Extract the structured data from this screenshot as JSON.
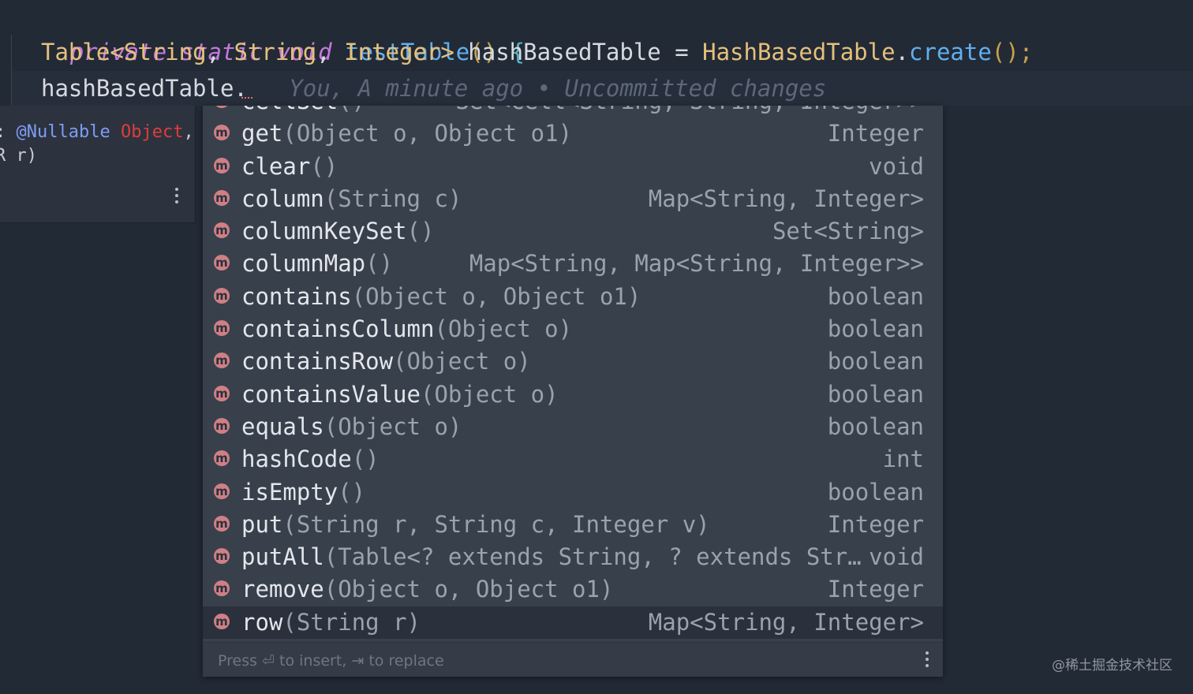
{
  "editor": {
    "line1": {
      "modifiers": "private static void",
      "method": "testTable",
      "parens": "()",
      "brace": "{"
    },
    "line2": {
      "table_type": "Table",
      "lt": "<",
      "generic1": "String",
      "comma1": ", ",
      "generic2": "String",
      "comma2": ", ",
      "generic3": "Integer",
      "gt": ">",
      "var": " hashBasedTable = ",
      "class": "HashBasedTable",
      "dot": ".",
      "create": "create",
      "call": "();"
    },
    "line3": {
      "text": "hashBasedTable.",
      "blame": "You, A minute ago • Uncommitted changes"
    }
  },
  "param_popup": {
    "prefix": ": ",
    "annotation": "@Nullable",
    "object": "Object",
    "comma": ",",
    "line2": "R r)"
  },
  "completion": {
    "items": [
      {
        "name": "cellSet",
        "sig": "()",
        "type": "Set<Cell<String, String, Integer>>"
      },
      {
        "name": "get",
        "sig": "(Object o, Object o1)",
        "type": "Integer"
      },
      {
        "name": "clear",
        "sig": "()",
        "type": "void"
      },
      {
        "name": "column",
        "sig": "(String c)",
        "type": "Map<String, Integer>"
      },
      {
        "name": "columnKeySet",
        "sig": "()",
        "type": "Set<String>"
      },
      {
        "name": "columnMap",
        "sig": "()",
        "type": "Map<String, Map<String, Integer>>"
      },
      {
        "name": "contains",
        "sig": "(Object o, Object o1)",
        "type": "boolean"
      },
      {
        "name": "containsColumn",
        "sig": "(Object o)",
        "type": "boolean"
      },
      {
        "name": "containsRow",
        "sig": "(Object o)",
        "type": "boolean"
      },
      {
        "name": "containsValue",
        "sig": "(Object o)",
        "type": "boolean"
      },
      {
        "name": "equals",
        "sig": "(Object o)",
        "type": "boolean"
      },
      {
        "name": "hashCode",
        "sig": "()",
        "type": "int"
      },
      {
        "name": "isEmpty",
        "sig": "()",
        "type": "boolean"
      },
      {
        "name": "put",
        "sig": "(String r, String c, Integer v)",
        "type": "Integer"
      },
      {
        "name": "putAll",
        "sig": "(Table<? extends String, ? extends Str…",
        "type": "void"
      },
      {
        "name": "remove",
        "sig": "(Object o, Object o1)",
        "type": "Integer"
      },
      {
        "name": "row",
        "sig": "(String r)",
        "type": "Map<String, Integer>"
      }
    ],
    "item_icon_letter": "m",
    "selected_index": 16,
    "footer": "Press ⏎ to insert, ⇥ to replace"
  },
  "watermark": "@稀土掘金技术社区",
  "icons": {
    "method": "method-icon",
    "more": "kebab-menu-icon"
  }
}
